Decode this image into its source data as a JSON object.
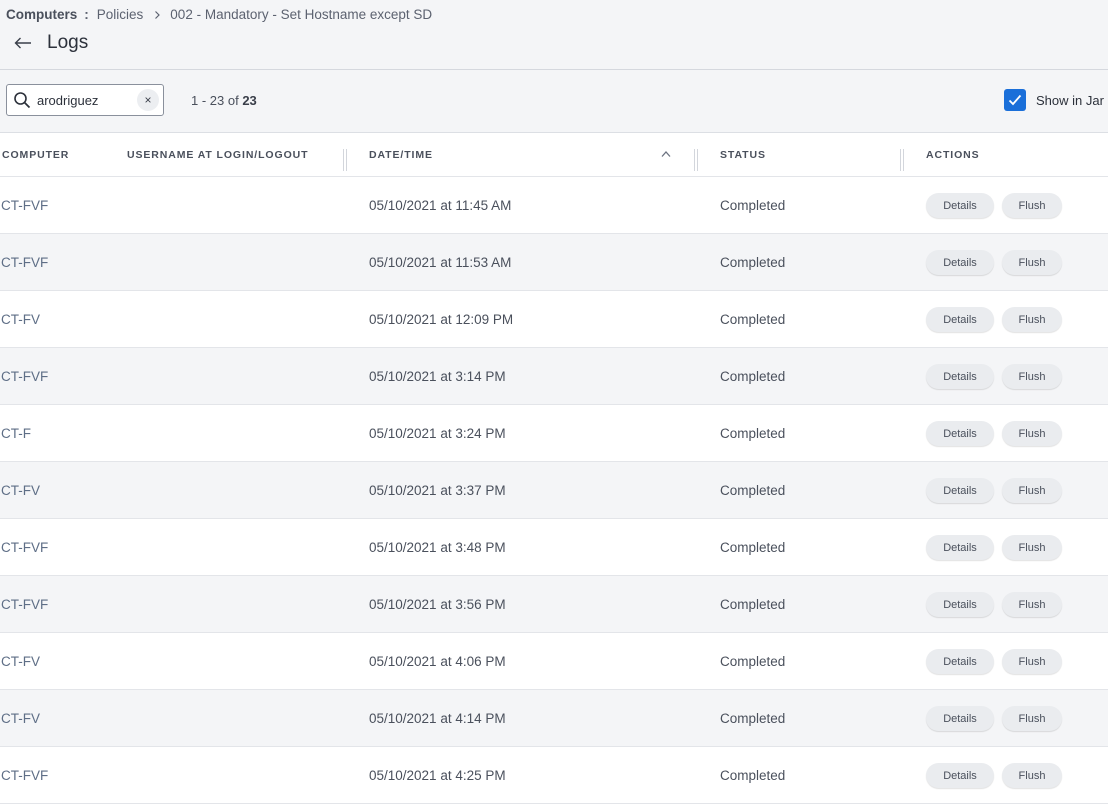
{
  "breadcrumb": {
    "root": "Computers",
    "level1": "Policies",
    "level2": "002 - Mandatory - Set Hostname except SD"
  },
  "page": {
    "title": "Logs"
  },
  "toolbar": {
    "search_value": "arodriguez",
    "clear_label": "×",
    "pagination_range": "1 - 23 of ",
    "pagination_total": "23",
    "show_in_label": "Show in Jar",
    "show_in_checked": true
  },
  "table": {
    "columns": [
      "COMPUTER",
      "USERNAME AT LOGIN/LOGOUT",
      "DATE/TIME",
      "STATUS",
      "ACTIONS"
    ],
    "sorted_column": "DATE/TIME",
    "sort_direction": "ascending",
    "rows": [
      {
        "computer": "CT-FVF",
        "username": "",
        "datetime": "05/10/2021 at 11:45 AM",
        "status": "Completed",
        "details": "Details",
        "flush": "Flush"
      },
      {
        "computer": "CT-FVF",
        "username": "",
        "datetime": "05/10/2021 at 11:53 AM",
        "status": "Completed",
        "details": "Details",
        "flush": "Flush"
      },
      {
        "computer": "CT-FV",
        "username": "",
        "datetime": "05/10/2021 at 12:09 PM",
        "status": "Completed",
        "details": "Details",
        "flush": "Flush"
      },
      {
        "computer": "CT-FVF",
        "username": "",
        "datetime": "05/10/2021 at 3:14 PM",
        "status": "Completed",
        "details": "Details",
        "flush": "Flush"
      },
      {
        "computer": "CT-F",
        "username": "",
        "datetime": "05/10/2021 at 3:24 PM",
        "status": "Completed",
        "details": "Details",
        "flush": "Flush"
      },
      {
        "computer": "CT-FV",
        "username": "",
        "datetime": "05/10/2021 at 3:37 PM",
        "status": "Completed",
        "details": "Details",
        "flush": "Flush"
      },
      {
        "computer": "CT-FVF",
        "username": "",
        "datetime": "05/10/2021 at 3:48 PM",
        "status": "Completed",
        "details": "Details",
        "flush": "Flush"
      },
      {
        "computer": "CT-FVF",
        "username": "",
        "datetime": "05/10/2021 at 3:56 PM",
        "status": "Completed",
        "details": "Details",
        "flush": "Flush"
      },
      {
        "computer": "CT-FV",
        "username": "",
        "datetime": "05/10/2021 at 4:06 PM",
        "status": "Completed",
        "details": "Details",
        "flush": "Flush"
      },
      {
        "computer": "CT-FV",
        "username": "",
        "datetime": "05/10/2021 at 4:14 PM",
        "status": "Completed",
        "details": "Details",
        "flush": "Flush"
      },
      {
        "computer": "CT-FVF",
        "username": "",
        "datetime": "05/10/2021 at 4:25 PM",
        "status": "Completed",
        "details": "Details",
        "flush": "Flush"
      }
    ]
  },
  "colors": {
    "accent": "#1a6fd9",
    "computer_link": "#5e6e86",
    "row_alt": "#f4f5f7"
  },
  "icons": [
    "back-arrow-icon",
    "search-icon",
    "close-icon",
    "checkmark-icon",
    "sort-ascending-icon",
    "chevron-right-icon"
  ]
}
